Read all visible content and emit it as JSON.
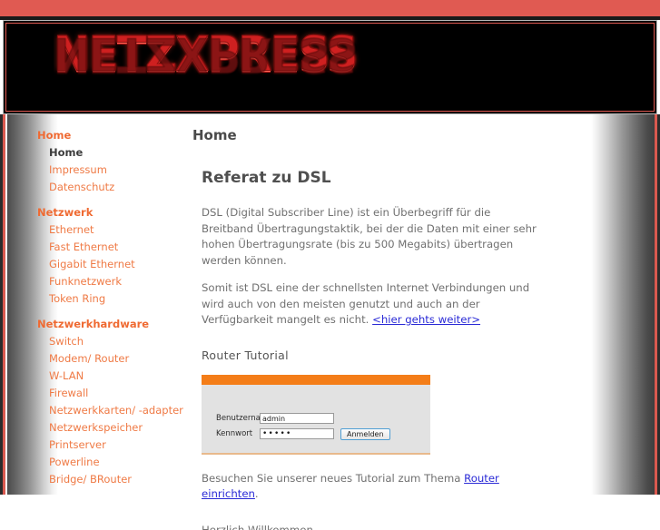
{
  "site": {
    "logo_text": "NETZXPRESS",
    "band_color": "#e05a52",
    "accent_color": "#ef6a32",
    "link_color": "#2a2ad6"
  },
  "sidebar": {
    "groups": [
      {
        "header": "Home",
        "items": [
          {
            "label": "Home",
            "active": true
          },
          {
            "label": "Impressum",
            "active": false
          },
          {
            "label": "Datenschutz",
            "active": false
          }
        ]
      },
      {
        "header": "Netzwerk",
        "items": [
          {
            "label": "Ethernet",
            "active": false
          },
          {
            "label": "Fast Ethernet",
            "active": false
          },
          {
            "label": "Gigabit Ethernet",
            "active": false
          },
          {
            "label": "Funknetzwerk",
            "active": false
          },
          {
            "label": "Token Ring",
            "active": false
          }
        ]
      },
      {
        "header": "Netzwerkhardware",
        "items": [
          {
            "label": "Switch",
            "active": false
          },
          {
            "label": "Modem/ Router",
            "active": false
          },
          {
            "label": "W-LAN",
            "active": false
          },
          {
            "label": "Firewall",
            "active": false
          },
          {
            "label": "Netzwerkkarten/ -adapter",
            "active": false
          },
          {
            "label": "Netzwerkspeicher",
            "active": false
          },
          {
            "label": "Printserver",
            "active": false
          },
          {
            "label": "Powerline",
            "active": false
          },
          {
            "label": "Bridge/ BRouter",
            "active": false
          }
        ]
      }
    ]
  },
  "content": {
    "page_title": "Home",
    "article_heading": "Referat zu DSL",
    "paragraph_1": "DSL (Digital Subscriber Line) ist ein Überbegriff für die Breitband Übertragungstaktik, bei der die  Daten mit einer sehr hohen Übertragungsrate (bis zu 500 Megabits) übertragen werden können.",
    "paragraph_2_before": "Somit ist DSL eine der schnellsten Internet Verbindungen und wird auch von den meisten genutzt und auch an der Verfügbarkeit mangelt es nicht. ",
    "paragraph_2_link": "<hier gehts weiter>",
    "subheading": "Router Tutorial",
    "paragraph_3_before": "Besuchen Sie unserer neues Tutorial zum Thema ",
    "paragraph_3_link": "Router einrichten",
    "paragraph_3_after": ".",
    "paragraph_4_cut": "Herzlich Willkommen..."
  },
  "router_login": {
    "username_label": "Benutzername",
    "username_value": "admin",
    "password_label": "Kennwort",
    "password_value": "•••••",
    "submit_label": "Anmelden",
    "bar_color": "#f47d18"
  }
}
